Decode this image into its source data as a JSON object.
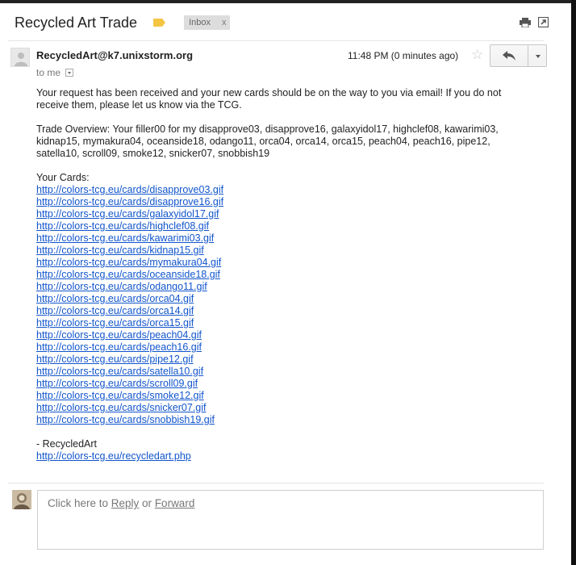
{
  "email": {
    "subject": "Recycled Art Trade",
    "label_chip": "Inbox",
    "label_chip_remove": "x",
    "label_color": "#f4c542",
    "sender": "RecycledArt@k7.unixstorm.org",
    "recipient": "to me",
    "time": "11:48 PM (0 minutes ago)",
    "star_glyph": "☆",
    "icons": [
      "print-icon",
      "new-window-icon",
      "star-icon",
      "reply-icon",
      "more-dropdown-icon"
    ]
  },
  "message": {
    "paragraph1": "Your request has been received and your new cards should be on the way to you via email!  If you do not receive them, please let us know via the TCG.",
    "trade_overview": "Trade Overview: Your filler00 for my disapprove03, disapprove16, galaxyidol17, highclef08, kawarimi03, kidnap15, mymakura04, oceanside18, odango11, orca04, orca14, orca15, peach04, peach16, pipe12, satella10, scroll09, smoke12, snicker07, snobbish19",
    "cards_heading": "Your Cards:",
    "card_links": [
      "http://colors-tcg.eu/cards/disapprove03.gif",
      "http://colors-tcg.eu/cards/disapprove16.gif",
      "http://colors-tcg.eu/cards/galaxyidol17.gif",
      "http://colors-tcg.eu/cards/highclef08.gif",
      "http://colors-tcg.eu/cards/kawarimi03.gif",
      "http://colors-tcg.eu/cards/kidnap15.gif",
      "http://colors-tcg.eu/cards/mymakura04.gif",
      "http://colors-tcg.eu/cards/oceanside18.gif",
      "http://colors-tcg.eu/cards/odango11.gif",
      "http://colors-tcg.eu/cards/orca04.gif",
      "http://colors-tcg.eu/cards/orca14.gif",
      "http://colors-tcg.eu/cards/orca15.gif",
      "http://colors-tcg.eu/cards/peach04.gif",
      "http://colors-tcg.eu/cards/peach16.gif",
      "http://colors-tcg.eu/cards/pipe12.gif",
      "http://colors-tcg.eu/cards/satella10.gif",
      "http://colors-tcg.eu/cards/scroll09.gif",
      "http://colors-tcg.eu/cards/smoke12.gif",
      "http://colors-tcg.eu/cards/snicker07.gif",
      "http://colors-tcg.eu/cards/snobbish19.gif"
    ],
    "signature": "- RecycledArt",
    "signature_link": "http://colors-tcg.eu/recycledart.php",
    "link_color": "#1155cc"
  },
  "reply_box": {
    "prefix": "Click here to ",
    "reply_label": "Reply",
    "or_text": " or ",
    "forward_label": "Forward"
  }
}
